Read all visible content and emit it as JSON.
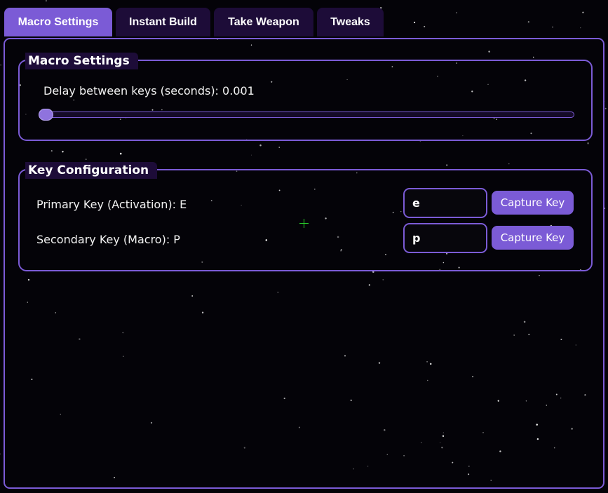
{
  "tabs": [
    {
      "label": "Macro Settings",
      "active": true
    },
    {
      "label": "Instant Build",
      "active": false
    },
    {
      "label": "Take Weapon",
      "active": false
    },
    {
      "label": "Tweaks",
      "active": false
    }
  ],
  "macro_settings": {
    "group_title": "Macro Settings",
    "delay_label": "Delay between keys (seconds): 0.001",
    "delay_slider_fraction": 0.0
  },
  "key_config": {
    "group_title": "Key Configuration",
    "primary": {
      "label": "Primary Key (Activation): E",
      "value": "e",
      "button_label": "Capture Key"
    },
    "secondary": {
      "label": "Secondary Key (Macro): P",
      "value": "p",
      "button_label": "Capture Key"
    }
  },
  "colors": {
    "accent": "#7b5bd6",
    "tab_inactive": "#1d0c38",
    "background": "#040308",
    "crosshair": "#2bd22b"
  },
  "icons": {
    "crosshair": "crosshair-icon"
  }
}
